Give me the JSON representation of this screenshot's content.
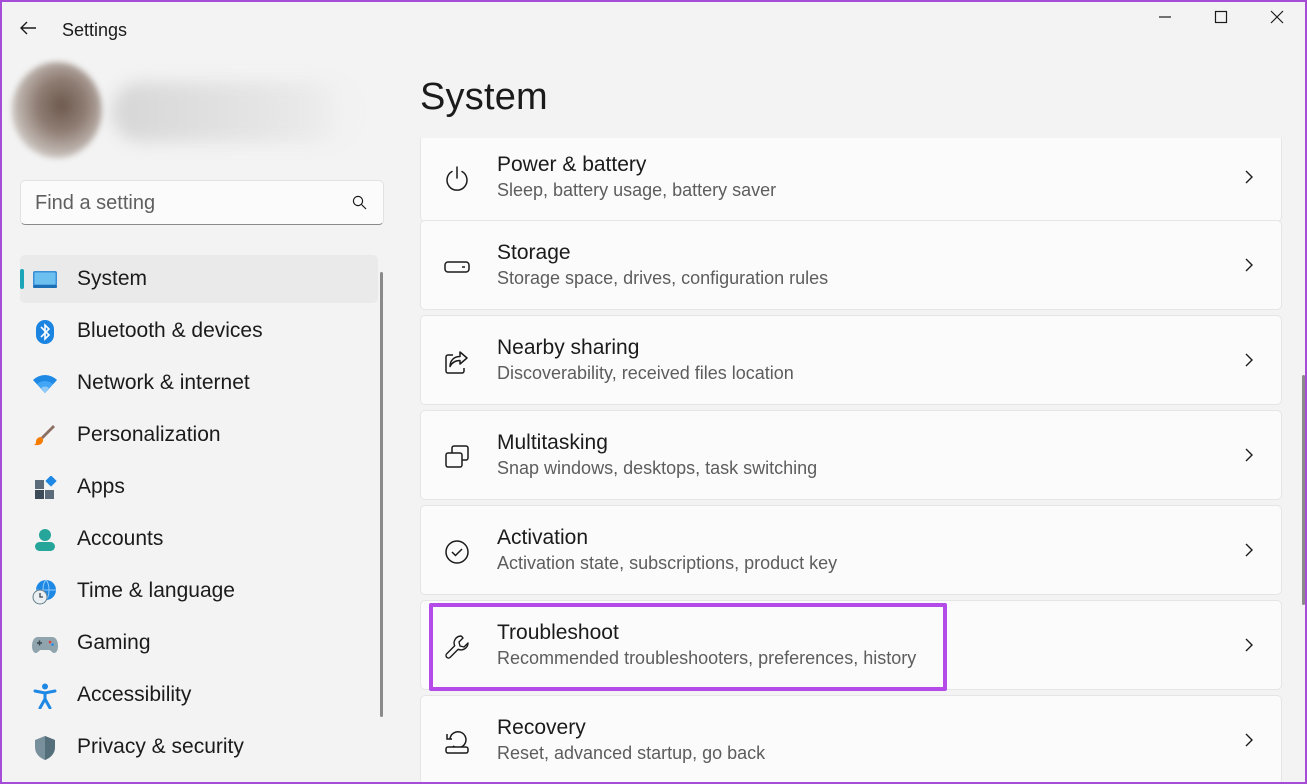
{
  "window": {
    "title": "Settings"
  },
  "titlebar": {
    "back_icon": "arrow-left-icon",
    "controls": [
      "minimize-icon",
      "maximize-icon",
      "close-icon"
    ]
  },
  "search": {
    "placeholder": "Find a setting",
    "value": "",
    "icon": "search-icon"
  },
  "nav": {
    "items": [
      {
        "label": "System",
        "icon": "monitor-icon",
        "active": true
      },
      {
        "label": "Bluetooth & devices",
        "icon": "bluetooth-icon"
      },
      {
        "label": "Network & internet",
        "icon": "wifi-icon"
      },
      {
        "label": "Personalization",
        "icon": "brush-icon"
      },
      {
        "label": "Apps",
        "icon": "apps-icon"
      },
      {
        "label": "Accounts",
        "icon": "person-icon"
      },
      {
        "label": "Time & language",
        "icon": "globe-clock-icon"
      },
      {
        "label": "Gaming",
        "icon": "gamepad-icon"
      },
      {
        "label": "Accessibility",
        "icon": "accessibility-icon"
      },
      {
        "label": "Privacy & security",
        "icon": "shield-icon"
      }
    ]
  },
  "main": {
    "title": "System",
    "cards": [
      {
        "title": "Power & battery",
        "subtitle": "Sleep, battery usage, battery saver",
        "icon": "power-icon"
      },
      {
        "title": "Storage",
        "subtitle": "Storage space, drives, configuration rules",
        "icon": "storage-icon"
      },
      {
        "title": "Nearby sharing",
        "subtitle": "Discoverability, received files location",
        "icon": "share-icon"
      },
      {
        "title": "Multitasking",
        "subtitle": "Snap windows, desktops, task switching",
        "icon": "multitasking-icon"
      },
      {
        "title": "Activation",
        "subtitle": "Activation state, subscriptions, product key",
        "icon": "checkmark-circle-icon"
      },
      {
        "title": "Troubleshoot",
        "subtitle": "Recommended troubleshooters, preferences, history",
        "icon": "wrench-icon",
        "highlighted": true
      },
      {
        "title": "Recovery",
        "subtitle": "Reset, advanced startup, go back",
        "icon": "recovery-icon"
      }
    ]
  },
  "colors": {
    "accent": "#1aa5b8",
    "highlight": "#b44ae8",
    "window_border": "#a64dd8"
  }
}
